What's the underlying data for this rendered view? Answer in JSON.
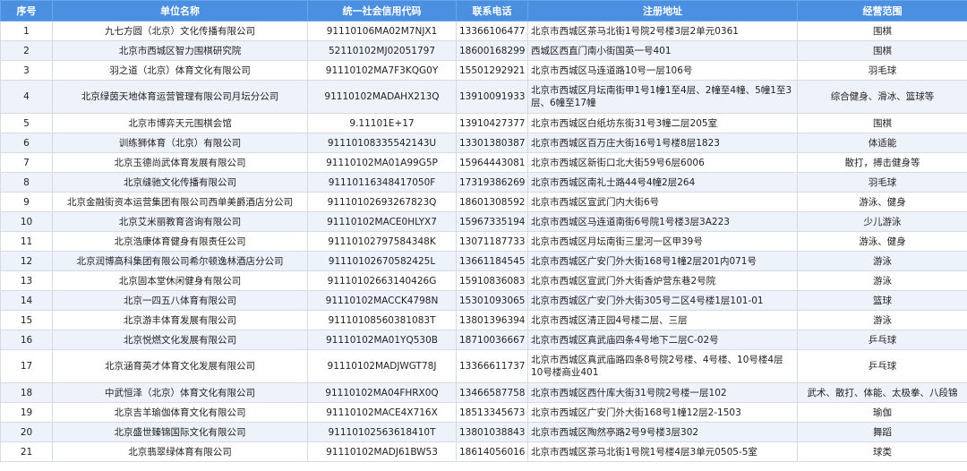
{
  "columns": [
    "序号",
    "单位名称",
    "统一社会信用代码",
    "联系电话",
    "注册地址",
    "经营范围"
  ],
  "rows": [
    {
      "no": "1",
      "name": "九七方圆（北京）文化传播有限公司",
      "code": "91110106MA02M7NJX1",
      "phone": "13366106477",
      "address": "北京市西城区茶马北街1号院2号楼3层2单元0361",
      "scope": "围棋"
    },
    {
      "no": "2",
      "name": "北京市西城区智力围棋研究院",
      "code": "52110102MJ02051797",
      "phone": "18600168299",
      "address": "西城区西直门南小街国英一号401",
      "scope": "围棋"
    },
    {
      "no": "3",
      "name": "羽之道（北京）体育文化有限公司",
      "code": "91110102MA7F3KQG0Y",
      "phone": "15501292921",
      "address": "北京市西城区马连道路10号一层106号",
      "scope": "羽毛球"
    },
    {
      "no": "4",
      "name": "北京绿茵天地体育运营管理有限公司月坛分公司",
      "code": "91110102MADAHX213Q",
      "phone": "13910091933",
      "address": "北京市西城区月坛南街甲1号1幢1至4层、2幢至4幢、5幢1至3层、6幢至17幢",
      "scope": "综合健身、滑冰、篮球等",
      "tall": true
    },
    {
      "no": "5",
      "name": "北京市博弈天元围棋会馆",
      "code": "9.11101E+17",
      "phone": "13910427377",
      "address": "北京市西城区白纸坊东街31号3幢二层205室",
      "scope": "围棋"
    },
    {
      "no": "6",
      "name": "训练狮体育（北京）有限公司",
      "code": "91110108335542143U",
      "phone": "13301380387",
      "address": "北京市西城区百万庄大街16号1号楼8层1823",
      "scope": "体适能"
    },
    {
      "no": "7",
      "name": "北京玉德尚武体育发展有限公司",
      "code": "91110102MA01A99G5P",
      "phone": "15964443081",
      "address": "北京市西城区新街口北大街59号6层6006",
      "scope": "散打，搏击健身等"
    },
    {
      "no": "8",
      "name": "北京缝驰文化传播有限公司",
      "code": "91110116348417050F",
      "phone": "17319386269",
      "address": "北京市西城区南礼士路44号4幢2层264",
      "scope": "羽毛球"
    },
    {
      "no": "9",
      "name": "北京金融街资本运营集团有限公司西单美爵酒店分公司",
      "code": "91110102693267823Q",
      "phone": "18601308592",
      "address": "北京市西城区宣武门内大街6号",
      "scope": "游泳、健身"
    },
    {
      "no": "10",
      "name": "北京艾米丽教育咨询有限公司",
      "code": "91110102MACE0HLYX7",
      "phone": "15967335194",
      "address": "北京市西城区马连道南街6号院1号楼3层3A223",
      "scope": "少儿游泳"
    },
    {
      "no": "11",
      "name": "北京浩康体育健身有限责任公司",
      "code": "91110102797584348K",
      "phone": "13071187733",
      "address": "北京市西城区月坛南街三里河一区甲39号",
      "scope": "游泳、健身"
    },
    {
      "no": "12",
      "name": "北京润博高科集团有限公司希尔顿逸林酒店分公司",
      "code": "91110102670582425L",
      "phone": "13661184545",
      "address": "北京市西城区广安门外大街168号1幢2层201内071号",
      "scope": "游泳"
    },
    {
      "no": "13",
      "name": "北京固本堂休闲健身有限公司",
      "code": "91110102663140426G",
      "phone": "15910836083",
      "address": "北京市西城区宣武门外大街香炉营东巷2号院",
      "scope": "游泳"
    },
    {
      "no": "14",
      "name": "北京一四五八体育有限公司",
      "code": "91110102MACCK4798N",
      "phone": "15301093065",
      "address": "北京市西城区广安门外大街305号二区4号楼1层101-01",
      "scope": "篮球"
    },
    {
      "no": "15",
      "name": "北京游丰体育发展有限公司",
      "code": "91110108560381083T",
      "phone": "13801396394",
      "address": "北京市西城区清正园4号楼二层、三层",
      "scope": "游泳"
    },
    {
      "no": "16",
      "name": "北京悦燃文化发展有限公司",
      "code": "91110102MA01YQ530B",
      "phone": "18710036667",
      "address": "北京市西城区真武庙四条4号地下二层C-02号",
      "scope": "乒乓球"
    },
    {
      "no": "17",
      "name": "北京涵育英才体育文化发展有限公司",
      "code": "91110102MADJWGT78J",
      "phone": "13366611737",
      "address": "北京市西城区真武庙路四条8号院2号楼、4号楼、10号楼4层10号楼商业401",
      "scope": "乒乓球",
      "tall": true
    },
    {
      "no": "18",
      "name": "中武恒泽（北京）体育文化有限公司",
      "code": "91110102MA04FHRX0Q",
      "phone": "13466587758",
      "address": "北京市西城区西什库大街31号院2号楼一层102",
      "scope": "武术、散打、体能、太极拳、八段锦"
    },
    {
      "no": "19",
      "name": "北京吉羊瑜伽体育文化有限公司",
      "code": "91110102MACE4X716X",
      "phone": "18513345673",
      "address": "北京市西城区广安门外大街168号1幢12层2-1503",
      "scope": "瑜伽"
    },
    {
      "no": "20",
      "name": "北京盛世臻锦国际文化有限公司",
      "code": "91110102563618410T",
      "phone": "13801038843",
      "address": "北京市西城区陶然亭路2号9号楼3层302",
      "scope": "舞蹈"
    },
    {
      "no": "21",
      "name": "北京翡翠绿体育有限公司",
      "code": "91110102MADJ61BW53",
      "phone": "18614056016",
      "address": "北京市西城区茶马北街1号院1号楼4层3单元0505-5室",
      "scope": "球类"
    }
  ]
}
